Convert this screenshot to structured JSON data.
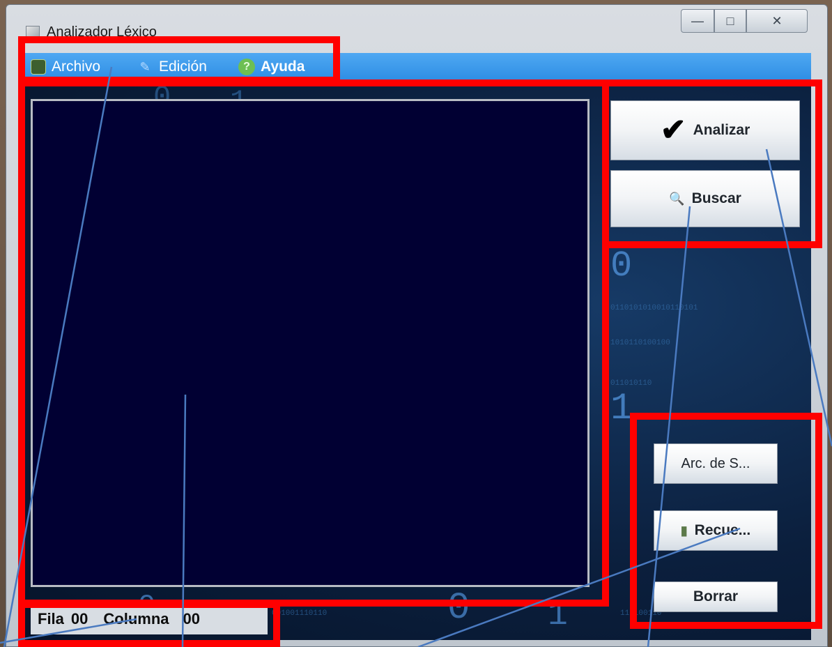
{
  "window": {
    "title": "Analizador Léxico",
    "controls": {
      "minimize": "—",
      "maximize": "□",
      "close": "✕"
    }
  },
  "menu": {
    "items": [
      {
        "label": "Archivo",
        "icon": "folder-icon"
      },
      {
        "label": "Edición",
        "icon": "pencil-icon"
      },
      {
        "label": "Ayuda",
        "icon": "help-icon",
        "icon_glyph": "?"
      }
    ]
  },
  "actions": {
    "analizar": {
      "label": "Analizar",
      "icon": "checkmark-icon",
      "icon_glyph": "✔"
    },
    "buscar": {
      "label": "Buscar",
      "icon": "magnifier-icon",
      "icon_glyph": "🔍"
    }
  },
  "file_actions": {
    "archivo_salida": {
      "label": "Arc. de S..."
    },
    "recuperar": {
      "label": "Recue...",
      "icon": "disk-icon",
      "icon_glyph": "▮"
    },
    "borrar": {
      "label": "Borrar"
    }
  },
  "status": {
    "row_label": "Fila",
    "row_value": "00",
    "col_label": "Columna",
    "col_value": "00"
  },
  "background_digits": [
    "0",
    "1",
    "0",
    "1",
    "0",
    "1",
    "0"
  ],
  "background_binary": [
    "0110101010010110101",
    "1010110100100",
    "011010110",
    "001001110110",
    "110100110"
  ],
  "colors": {
    "annotation": "#ff0000",
    "menubar": "#2d8de4",
    "editor": "#010033",
    "callout_line": "#4a7ac0"
  }
}
